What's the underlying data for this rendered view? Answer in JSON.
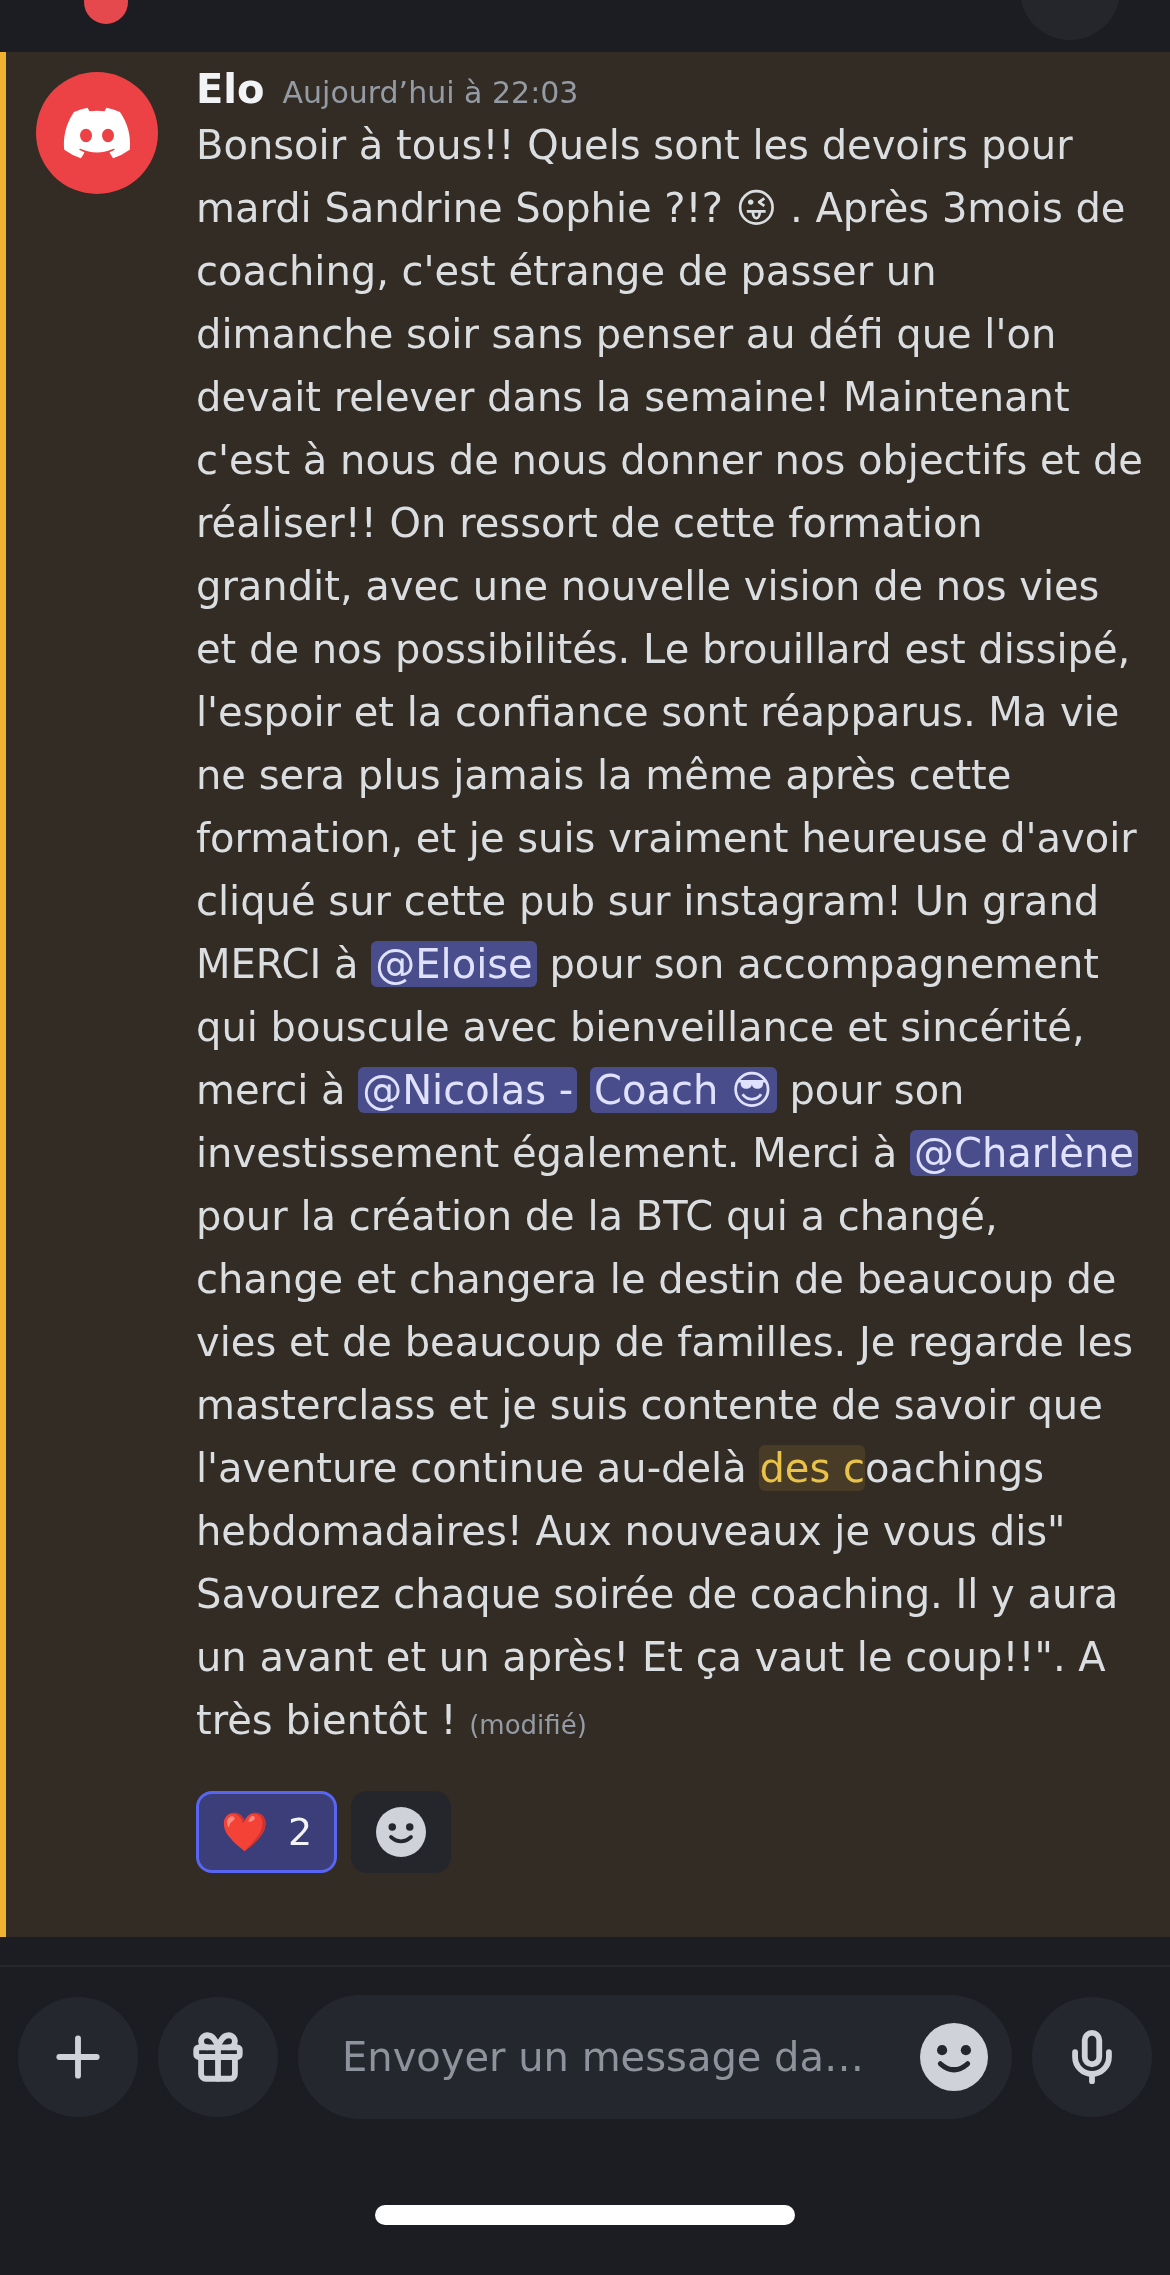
{
  "message": {
    "author": "Elo",
    "timestamp": "Aujourd’hui à 22:03",
    "highlighted": true,
    "body": [
      {
        "kind": "text",
        "text": "Bonsoir à tous!! Quels sont les devoirs pour mardi Sandrine Sophie ?!? "
      },
      {
        "kind": "emoji",
        "text": "😜"
      },
      {
        "kind": "text",
        "text": " . Après 3mois de coaching, c'est étrange de passer un dimanche soir sans penser au défi que l'on devait relever dans la semaine! Maintenant c'est à nous de nous donner nos objectifs et de réaliser!! On ressort de cette formation grandit, avec une nouvelle vision de nos vies et de nos possibilités. Le brouillard est dissipé, l'espoir et la confiance sont réapparus. Ma vie ne sera plus jamais la même après cette formation, et je suis vraiment heureuse d'avoir cliqué sur cette pub sur instagram! Un grand MERCI à "
      },
      {
        "kind": "mention",
        "text": "@Eloise"
      },
      {
        "kind": "text",
        "text": " pour son accompagnement qui bouscule avec bienveillance et sincérité, merci à "
      },
      {
        "kind": "mention",
        "text": "@Nicolas -"
      },
      {
        "kind": "mention",
        "text": "Coach 😎"
      },
      {
        "kind": "text",
        "text": " pour son investissement également. Merci à "
      },
      {
        "kind": "mention",
        "text": "@Charlène"
      },
      {
        "kind": "text",
        "text": " pour la création de la BTC qui a changé, change et changera le destin de beaucoup de vies et de beaucoup de familles. Je regarde les masterclass et je suis contente de savoir que l'aventure continue au-delà "
      },
      {
        "kind": "highlight",
        "text": "des c"
      },
      {
        "kind": "text",
        "text": "oachings hebdomadaires! Aux nouveaux je vous dis\" Savourez chaque soirée de coaching. Il y aura un avant et un après! Et ça vaut le coup!!\". A très bientôt !"
      }
    ],
    "edited": "(modifié)",
    "reactions": [
      {
        "emoji": "❤️",
        "count": "2",
        "selected": true
      }
    ]
  },
  "composer": {
    "placeholder": "Envoyer un message da…"
  }
}
